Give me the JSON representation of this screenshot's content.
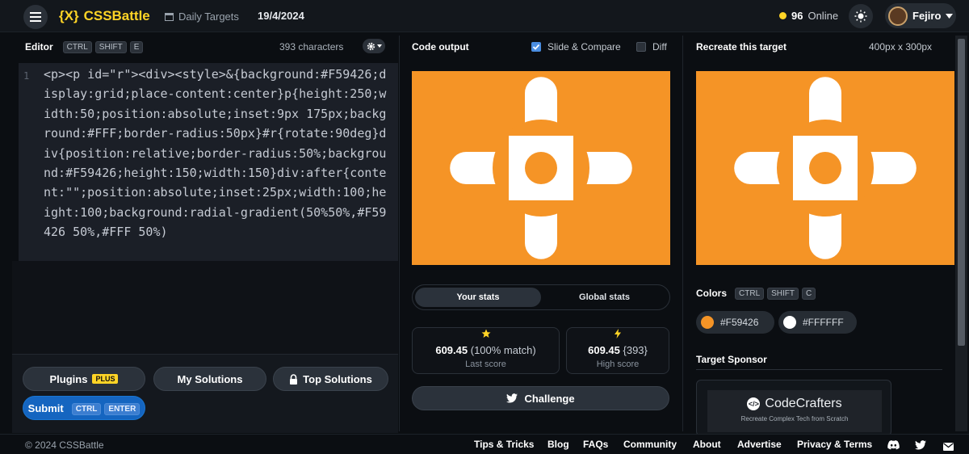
{
  "header": {
    "logo_mark": "{X}",
    "logo_text": "CSSBattle",
    "breadcrumb": "Daily Targets",
    "date": "19/4/2024",
    "online_count": "96",
    "online_label": "Online",
    "username": "Fejiro"
  },
  "editor": {
    "title": "Editor",
    "shortcut": [
      "CTRL",
      "SHIFT",
      "E"
    ],
    "char_count": "393 characters",
    "line_number": "1",
    "code": "<p><p id=\"r\"><div><style>&{background:#F59426;display:grid;place-content:center}p{height:250;width:50;position:absolute;inset:9px 175px;background:#FFF;border-radius:50px}#r{rotate:90deg}div{position:relative;border-radius:50%;background:#F59426;height:150;width:150}div:after{content:\"\";position:absolute;inset:25px;width:100;height:100;background:radial-gradient(50%50%,#F59426 50%,#FFF 50%)"
  },
  "actions": {
    "plugins": "Plugins",
    "plugins_badge": "PLUS",
    "my_solutions": "My Solutions",
    "top_solutions": "Top Solutions",
    "submit": "Submit",
    "submit_shortcut": [
      "CTRL",
      "ENTER"
    ]
  },
  "output": {
    "title": "Code output",
    "slide_compare": "Slide & Compare",
    "slide_compare_checked": true,
    "diff": "Diff",
    "diff_checked": false
  },
  "stats": {
    "tab_your": "Your stats",
    "tab_global": "Global stats",
    "last_score": "609.45",
    "last_match": "(100% match)",
    "last_label": "Last score",
    "high_score": "609.45",
    "high_chars": "{393}",
    "high_label": "High score",
    "challenge": "Challenge"
  },
  "target": {
    "title": "Recreate this target",
    "size": "400px x 300px",
    "colors_label": "Colors",
    "colors_shortcut": [
      "CTRL",
      "SHIFT",
      "C"
    ],
    "colors": [
      {
        "hex": "#F59426"
      },
      {
        "hex": "#FFFFFF"
      }
    ],
    "sponsor_label": "Target Sponsor",
    "sponsor_name": "CodeCrafters",
    "sponsor_tagline": "Recreate Complex Tech from Scratch"
  },
  "footer": {
    "copyright": "© 2024 CSSBattle",
    "links": [
      "Tips & Tricks",
      "Blog",
      "FAQs",
      "Community",
      "About",
      "Advertise",
      "Privacy & Terms"
    ]
  },
  "theme": {
    "accent": "#ffd426",
    "submit_blue": "#1565c0",
    "target_orange": "#F59426",
    "target_white": "#FFFFFF"
  }
}
